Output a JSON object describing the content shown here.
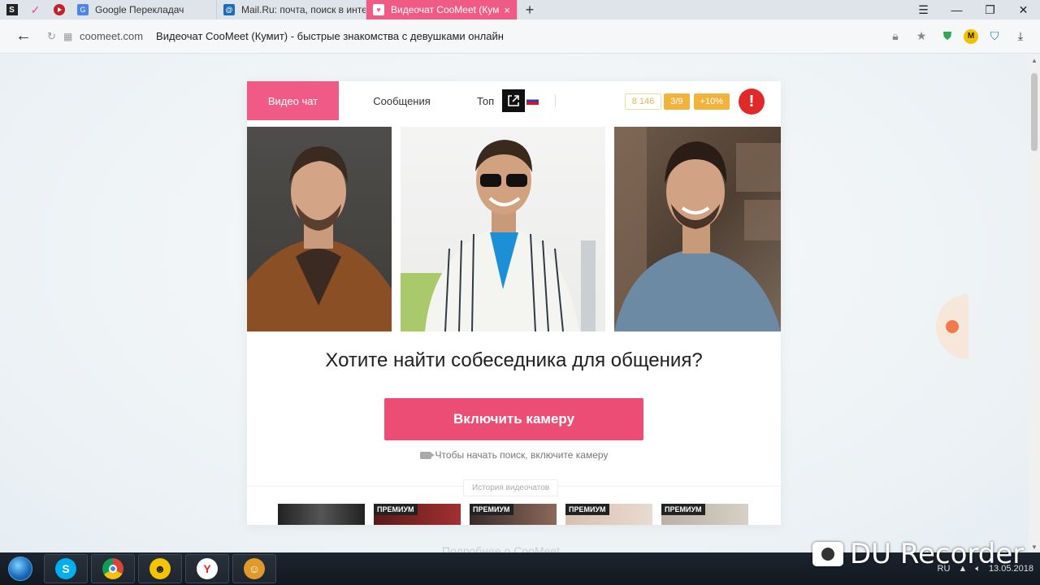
{
  "browser": {
    "tabs": [
      {
        "icon": "s-app-icon",
        "label": ""
      },
      {
        "icon": "vk-icon",
        "label": ""
      },
      {
        "icon": "youtube-icon",
        "label": ""
      },
      {
        "icon": "google-translate-icon",
        "label": "Google Перекладач"
      },
      {
        "icon": "mailru-icon",
        "label": "Mail.Ru: почта, поиск в инте"
      },
      {
        "icon": "coomeet-icon",
        "label": "Видеочат CooMeet (Кум"
      }
    ],
    "active_tab_index": 5,
    "address": {
      "domain": "coomeet.com",
      "page_title": "Видеочат CooMeet (Кумит) - быстрые знакомства с девушками онлайн"
    },
    "extensions": {
      "m_label": "M"
    }
  },
  "site": {
    "nav": {
      "video_chat": "Видео чат",
      "messages": "Сообщения",
      "top": "Топ"
    },
    "stats": {
      "count": "8 146",
      "fraction": "3/9",
      "bonus": "+10%",
      "alert": "!"
    },
    "headline": "Хотите найти собеседника для общения?",
    "camera_button": "Включить камеру",
    "hint": "Чтобы начать поиск, включите камеру",
    "history_label": "История видеочатов",
    "premium_badge": "ПРЕМИУМ",
    "footer_ghost": "Подробнее о CooMeet"
  },
  "overlay": {
    "watermark": "DU Recorder",
    "tray_lang": "RU",
    "tray_date": "13.05.2018"
  },
  "colors": {
    "brand_pink": "#ec4d74",
    "stat_orange": "#f2b33d",
    "alert_red": "#e02a2a"
  }
}
